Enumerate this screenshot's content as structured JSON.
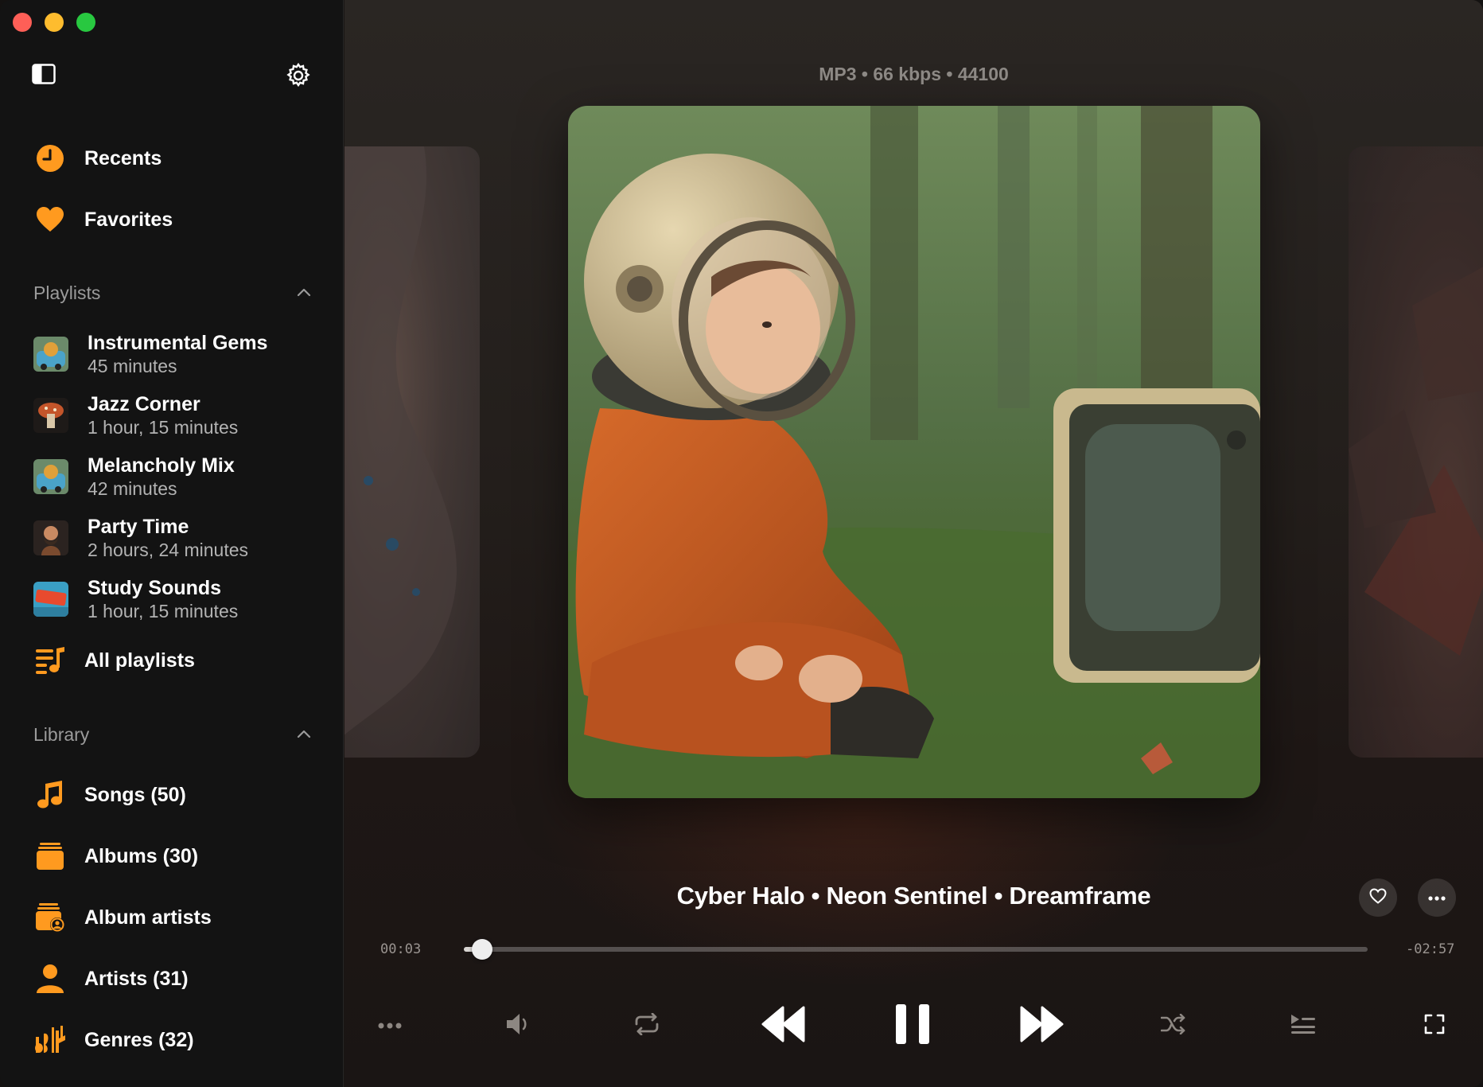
{
  "window": {
    "controls": [
      "close",
      "minimize",
      "zoom"
    ],
    "colors": {
      "close": "#fe5f57",
      "minimize": "#febc2e",
      "zoom": "#28c840"
    }
  },
  "sidebar": {
    "toggle_icon": "sidebar-icon",
    "settings_icon": "gear-icon",
    "accent": "#ff9a1f",
    "top_items": [
      {
        "label": "Recents",
        "icon": "clock-icon"
      },
      {
        "label": "Favorites",
        "icon": "heart-icon"
      }
    ],
    "playlists_header": "Playlists",
    "playlists": [
      {
        "name": "Instrumental Gems",
        "duration": "45 minutes"
      },
      {
        "name": "Jazz Corner",
        "duration": "1 hour, 15 minutes"
      },
      {
        "name": "Melancholy Mix",
        "duration": "42 minutes"
      },
      {
        "name": "Party Time",
        "duration": "2 hours, 24 minutes"
      },
      {
        "name": "Study Sounds",
        "duration": "1 hour, 15 minutes"
      }
    ],
    "all_playlists": "All playlists",
    "library_header": "Library",
    "library": [
      {
        "label": "Songs (50)",
        "icon": "music-note-icon"
      },
      {
        "label": "Albums (30)",
        "icon": "albums-icon"
      },
      {
        "label": "Album artists",
        "icon": "album-artists-icon"
      },
      {
        "label": "Artists (31)",
        "icon": "person-icon"
      },
      {
        "label": "Genres (32)",
        "icon": "genres-icon"
      }
    ]
  },
  "player": {
    "format_info": "MP3 • 66 kbps • 44100",
    "track_title": "Cyber Halo • Neon Sentinel • Dreamframe",
    "elapsed": "00:03",
    "remaining": "-02:57",
    "progress": 0.02,
    "controls": [
      "more-icon",
      "volume-icon",
      "repeat-icon",
      "previous-icon",
      "pause-icon",
      "next-icon",
      "shuffle-icon",
      "queue-icon",
      "fullscreen-icon"
    ]
  }
}
